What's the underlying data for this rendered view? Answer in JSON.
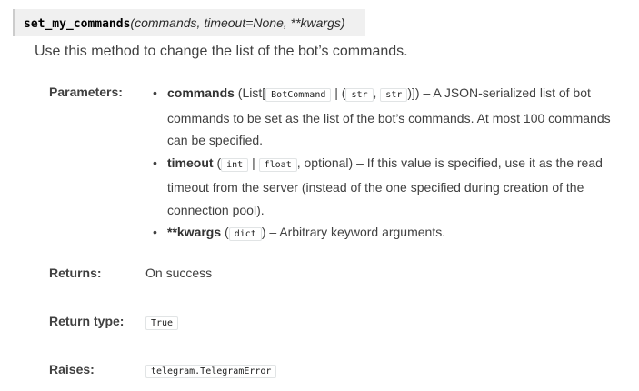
{
  "signature": {
    "name": "set_my_commands",
    "params": "(commands, timeout=None, **kwargs)"
  },
  "description": "Use this method to change the list of the bot’s commands.",
  "fields": {
    "parameters_label": "Parameters:",
    "returns_label": "Returns:",
    "return_type_label": "Return type:",
    "raises_label": "Raises:"
  },
  "params": {
    "p1": {
      "name": "commands",
      "t1": " (List[",
      "c1": "BotCommand",
      "t2": " | (",
      "c2": "str",
      "t3": ", ",
      "c3": "str",
      "t4": ")]) – A JSON-serialized list of bot commands to be set as the list of the bot’s commands. At most 100 commands can be specified."
    },
    "p2": {
      "name": "timeout",
      "t1": " (",
      "c1": "int",
      "t2": " | ",
      "c2": "float",
      "t3": ", optional) – If this value is specified, use it as the read timeout from the server (instead of the one specified during creation of the connection pool)."
    },
    "p3": {
      "name": "**kwargs",
      "t1": " (",
      "c1": "dict",
      "t2": ") – Arbitrary keyword arguments."
    }
  },
  "returns": "On success",
  "return_type": "True",
  "raises": "telegram.TelegramError"
}
